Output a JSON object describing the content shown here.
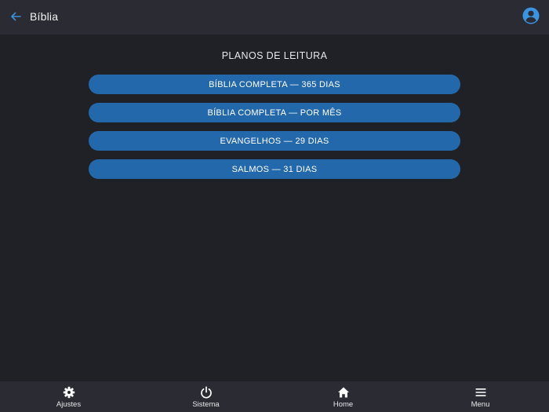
{
  "header": {
    "title": "Bíblia",
    "back_icon": "arrow-left-icon",
    "account_icon": "account-circle-icon"
  },
  "main": {
    "section_title": "PLANOS DE LEITURA",
    "plans": [
      {
        "label": "BÍBLIA COMPLETA — 365 DIAS"
      },
      {
        "label": "BÍBLIA COMPLETA — POR MÊS"
      },
      {
        "label": "EVANGELHOS — 29 DIAS"
      },
      {
        "label": "SALMOS — 31 DIAS"
      }
    ]
  },
  "bottom_nav": {
    "items": [
      {
        "label": "Ajustes",
        "icon": "gear-icon"
      },
      {
        "label": "Sistema",
        "icon": "power-icon"
      },
      {
        "label": "Home",
        "icon": "home-icon"
      },
      {
        "label": "Menu",
        "icon": "hamburger-menu-icon"
      }
    ]
  },
  "colors": {
    "background": "#202126",
    "bar": "#2b2c33",
    "accent": "#2368ab",
    "back_arrow": "#3a8fd8",
    "account": "#3a94e0"
  }
}
